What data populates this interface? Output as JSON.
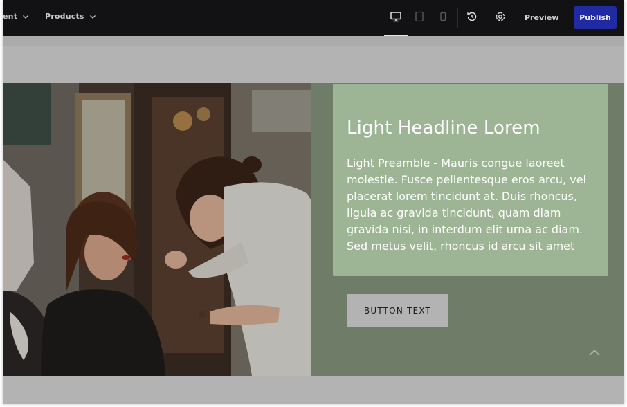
{
  "toolbar": {
    "nav": [
      {
        "label": "ent",
        "icon": "chevron-down-icon"
      },
      {
        "label": "Products",
        "icon": "chevron-down-icon"
      }
    ],
    "device_icons": [
      "desktop-icon",
      "tablet-icon",
      "mobile-icon"
    ],
    "active_device": "desktop",
    "history_icon": "history-icon",
    "settings_icon": "gear-icon",
    "preview_label": "Preview",
    "publish_label": "Publish"
  },
  "hero": {
    "headline": "Light Headline Lorem",
    "preamble": "Light Preamble - Mauris congue laoreet molestie. Fusce pellentesque eros arcu, vel placerat lorem tincidunt at. Duis rhoncus, ligula ac gravida tincidunt, quam diam gravida nisi, in interdum elit urna ac diam. Sed metus velit, rhoncus id arcu sit amet",
    "button_label": "BUTTON TEXT",
    "scroll_icon": "chevron-up-icon"
  },
  "colors": {
    "toolbar_bg": "#121214",
    "publish_bg": "#1f2aa3",
    "card_bg": "#9eb595",
    "panel_bg": "#6f7c67",
    "button_bg": "#b3b3b3"
  }
}
